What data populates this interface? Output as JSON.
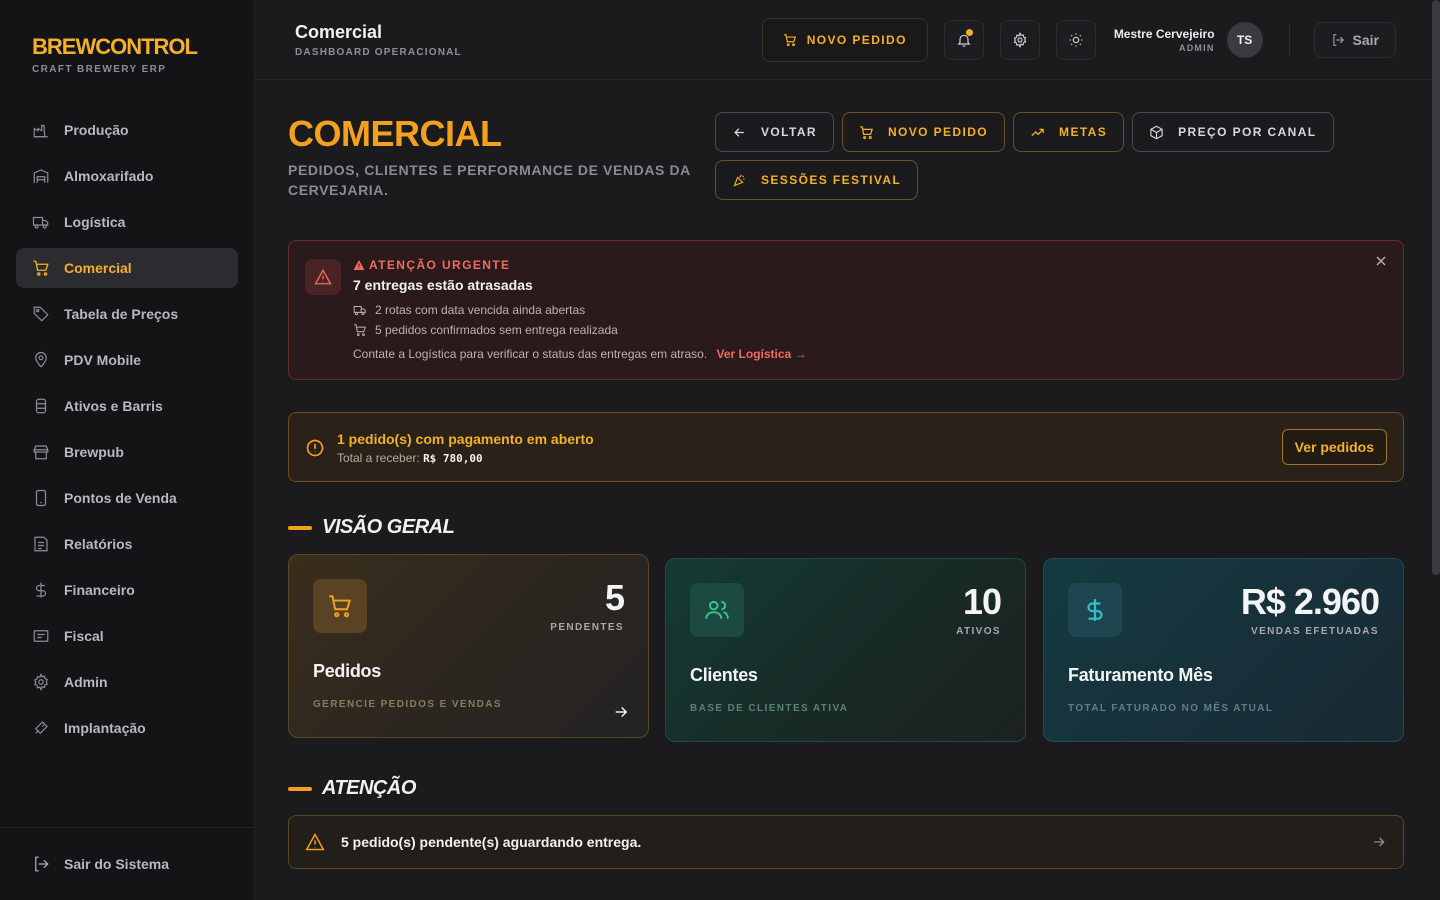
{
  "brand": {
    "name": "BREWCONTROL",
    "sub": "CRAFT BREWERY ERP"
  },
  "sidebar": {
    "items": [
      {
        "label": "Produção",
        "icon": "factory-icon"
      },
      {
        "label": "Almoxarifado",
        "icon": "warehouse-icon"
      },
      {
        "label": "Logística",
        "icon": "truck-icon"
      },
      {
        "label": "Comercial",
        "icon": "cart-icon",
        "active": true
      },
      {
        "label": "Tabela de Preços",
        "icon": "tag-icon"
      },
      {
        "label": "PDV Mobile",
        "icon": "map-pin-icon"
      },
      {
        "label": "Ativos e Barris",
        "icon": "barrel-icon"
      },
      {
        "label": "Brewpub",
        "icon": "store-icon"
      },
      {
        "label": "Pontos de Venda",
        "icon": "phone-icon"
      },
      {
        "label": "Relatórios",
        "icon": "report-icon"
      },
      {
        "label": "Financeiro",
        "icon": "dollar-icon"
      },
      {
        "label": "Fiscal",
        "icon": "receipt-icon"
      },
      {
        "label": "Admin",
        "icon": "gear-icon"
      },
      {
        "label": "Implantação",
        "icon": "rocket-icon"
      }
    ],
    "footer_label": "Sair do Sistema"
  },
  "topbar": {
    "title": "Comercial",
    "subtitle": "DASHBOARD OPERACIONAL",
    "new_order_label": "NOVO PEDIDO",
    "user_name": "Mestre Cervejeiro",
    "user_role": "ADMIN",
    "avatar_initials": "TS",
    "logout_label": "Sair"
  },
  "page": {
    "title": "COMERCIAL",
    "description": "PEDIDOS, CLIENTES E PERFORMANCE DE VENDAS DA CERVEJARIA.",
    "actions": {
      "back": "VOLTAR",
      "new_order": "NOVO PEDIDO",
      "goals": "METAS",
      "price_by_channel": "PREÇO POR CANAL",
      "festival_sessions": "SESSÕES FESTIVAL"
    }
  },
  "urgent_alert": {
    "label": "ATENÇÃO URGENTE",
    "title": "7 entregas estão atrasadas",
    "line1": "2 rotas com data vencida ainda abertas",
    "line2": "5 pedidos confirmados sem entrega realizada",
    "footer": "Contate a Logística para verificar o status das entregas em atraso.",
    "link": "Ver Logística →"
  },
  "payment_alert": {
    "title": "1 pedido(s) com pagamento em aberto",
    "sub_label": "Total a receber:",
    "amount": "R$ 780,00",
    "button": "Ver pedidos"
  },
  "overview": {
    "title": "VISÃO GERAL",
    "cards": {
      "orders": {
        "value": "5",
        "sub": "PENDENTES",
        "name": "Pedidos",
        "desc": "GERENCIE PEDIDOS E VENDAS"
      },
      "clients": {
        "value": "10",
        "sub": "ATIVOS",
        "name": "Clientes",
        "desc": "BASE DE CLIENTES ATIVA"
      },
      "revenue": {
        "value": "R$ 2.960",
        "sub": "VENDAS EFETUADAS",
        "name": "Faturamento Mês",
        "desc": "TOTAL FATURADO NO MÊS ATUAL"
      }
    }
  },
  "attention": {
    "title": "ATENÇÃO",
    "item": "5 pedido(s) pendente(s) aguardando entrega."
  },
  "colors": {
    "accent": "#f3b02b",
    "danger": "#f26a5e",
    "teal": "#2fc2c9",
    "green": "#3bc48a"
  }
}
